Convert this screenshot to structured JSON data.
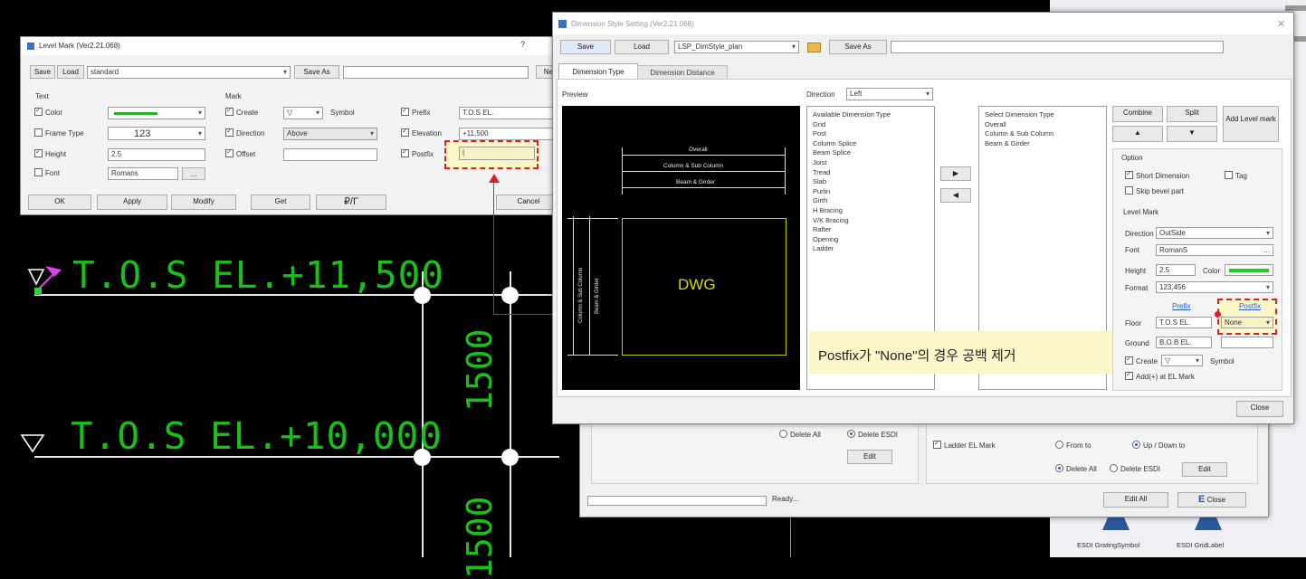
{
  "cad": {
    "level1": "T.O.S  EL.+11,500",
    "level2": "T.O.S  EL.+10,000",
    "dim1": "1500",
    "dim2": "1500"
  },
  "level_mark": {
    "title": "Level Mark (Ver2.21.068)",
    "help": "?",
    "save": "Save",
    "load": "Load",
    "style_value": "standard",
    "save_as": "Save As",
    "save_as_value": "",
    "new_partial": "Ne",
    "text_header": "Text",
    "mark_header": "Mark",
    "color": "Color",
    "frame_type": "Frame Type",
    "frame_sample": "123",
    "height": "Height",
    "height_value": "2.5",
    "font": "Font",
    "font_value": "Romans",
    "font_btn": "...",
    "create": "Create",
    "symbol": "Symbol",
    "direction": "Direction",
    "direction_value": "Above",
    "offset": "Offset",
    "offset_value": "",
    "prefix": "Prefix",
    "prefix_value": "T.O.S EL.",
    "elevation": "Elevation",
    "elevation_value": "+11,500",
    "postfix": "Postfix",
    "postfix_value": "|",
    "ok": "OK",
    "apply": "Apply",
    "modify": "Modify",
    "get": "Get",
    "symbol_btn": "₽/Γ",
    "cancel": "Cancel"
  },
  "dim_style": {
    "title": "Dimension Style Setting (Ver2.21.068)",
    "save": "Save",
    "load": "Load",
    "style_value": "LSP_DimStyle_plan",
    "save_as": "Save As",
    "save_as_value": "",
    "tab1": "Dimension Type",
    "tab2": "Dimension Distance",
    "preview": "Preview",
    "direction_label": "Direction",
    "direction_value": "Left",
    "preview_labels": {
      "overall": "Overall",
      "column_sub": "Column & Sub Column",
      "beam_girder": "Beam & Girder",
      "vert1": "Column & Sub Column",
      "vert2": "Beam & Girder",
      "dwg": "DWG"
    },
    "available_header": "Available Dimension Type",
    "available": [
      "Grid",
      "Post",
      "Column Splice",
      "Beam Splice",
      "Joist",
      "Tread",
      "Slab",
      "Purlin",
      "Girth",
      "H Bracing",
      "V/K Bracing",
      "Rafter",
      "Opening",
      "Ladder"
    ],
    "select_header": "Select Dimension Type",
    "selected": [
      "Overall",
      "Column & Sub Column",
      "Beam & Girder"
    ],
    "move_right": "▶",
    "move_left": "◀",
    "combine": "Combine",
    "split": "Split",
    "up": "▲",
    "down": "▼",
    "add_level_mark": "Add Level mark",
    "option": "Option",
    "short_dimension": "Short Dimension",
    "tag": "Tag",
    "skip_bevel": "Skip bevel part",
    "level_mark": "Level Mark",
    "lm_direction": "Direction",
    "lm_direction_value": "OutSide",
    "lm_font": "Font",
    "lm_font_value": "RomanS",
    "lm_font_btn": "...",
    "lm_height": "Height",
    "lm_height_value": "2.5",
    "lm_color": "Color",
    "lm_format": "Format",
    "lm_format_value": "123,456",
    "prefix_col": "Prefix",
    "postfix_col": "Postfix",
    "floor": "Floor",
    "floor_prefix": "T.O.S EL.",
    "floor_postfix": "None",
    "ground": "Ground",
    "ground_prefix": "B.O.B EL.",
    "ground_postfix": "",
    "create": "Create",
    "create_value": "▽",
    "symbol": "Symbol",
    "add_plus": "Add(+) at EL Mark",
    "close": "Close",
    "annotation": "Postfix가 \"None\"의 경우 공백 제거"
  },
  "back_window": {
    "delete_all": "Delete All",
    "delete_esdi": "Delete ESDI",
    "edit": "Edit",
    "ladder_el_mark": "Ladder EL Mark",
    "from_to": "From to",
    "up_down_to": "Up / Down to",
    "delete_all2": "Delete All",
    "delete_esdi2": "Delete ESDI",
    "edit2": "Edit",
    "edit_all": "Edit All",
    "close": "Close",
    "ready": "Ready..."
  },
  "right_panel": {
    "item1": "ESDI GratingSymbol",
    "item2": "ESDI GridLabel"
  },
  "colors": {
    "cad_green": "#17c117",
    "annotation_red": "#e02020",
    "highlight_yellow": "#fbf7c8",
    "dwg_yellow": "#d9d900"
  }
}
